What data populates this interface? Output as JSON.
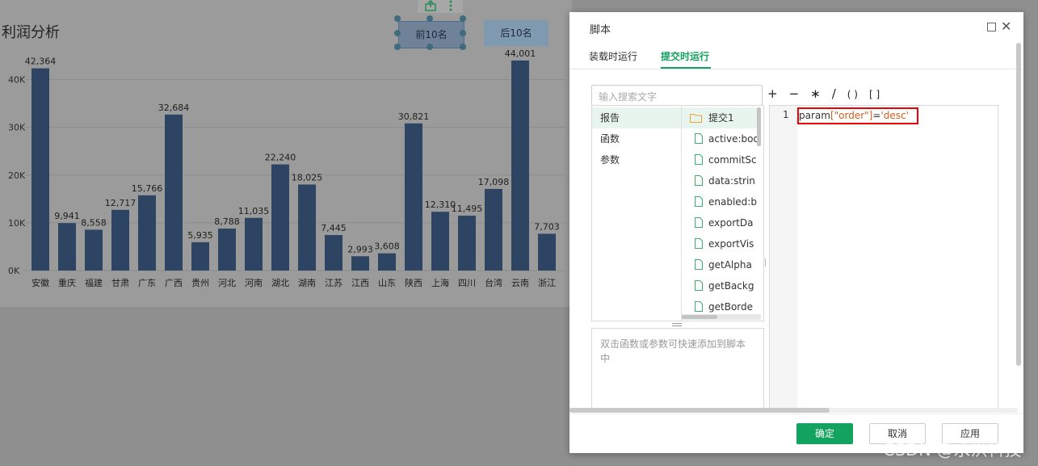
{
  "report": {
    "title": "利润分析",
    "btn_top10": "前10名",
    "btn_bottom10": "后10名"
  },
  "chart_data": {
    "type": "bar",
    "categories": [
      "安徽",
      "重庆",
      "福建",
      "甘肃",
      "广东",
      "广西",
      "贵州",
      "河北",
      "河南",
      "湖北",
      "湖南",
      "江苏",
      "江西",
      "山东",
      "陕西",
      "上海",
      "四川",
      "台湾",
      "云南",
      "浙江"
    ],
    "values": [
      42364,
      9941,
      8558,
      12717,
      15766,
      32684,
      5935,
      8788,
      11035,
      22240,
      18025,
      7445,
      2993,
      3608,
      30821,
      12310,
      11495,
      17098,
      44001,
      7703
    ],
    "value_labels": [
      "42,364",
      "9,941",
      "8,558",
      "12,717",
      "15,766",
      "32,684",
      "5,935",
      "8,788",
      "11,035",
      "22,240",
      "18,025",
      "7,445",
      "2,993",
      "3,608",
      "30,821",
      "12,310",
      "11,495",
      "17,098",
      "44,001",
      "7,703"
    ],
    "ytick_labels": [
      "0K",
      "10K",
      "20K",
      "30K",
      "40K"
    ],
    "ytick_values": [
      0,
      10000,
      20000,
      30000,
      40000
    ],
    "ylim": [
      0,
      45000
    ],
    "bar_color": "#2d4562",
    "grid": true
  },
  "dialog": {
    "title": "脚本",
    "tabs": [
      {
        "label": "装载时运行"
      },
      {
        "label": "提交时运行"
      }
    ],
    "search_placeholder": "输入搜索文字",
    "operators": [
      "+",
      "−",
      "∗",
      "/",
      "( )",
      "[ ]"
    ],
    "categories": [
      "报告",
      "函数",
      "参数"
    ],
    "tree_folder": "提交1",
    "tree_items": [
      "active:boo",
      "commitSc",
      "data:strin",
      "enabled:b",
      "exportDa",
      "exportVis",
      "getAlpha",
      "getBackg",
      "getBorde"
    ],
    "help_text": "双击函数或参数可快速添加到脚本中",
    "line_number": "1",
    "code": {
      "p1": "param",
      "p2": "[\"order\"]",
      "p3": "=",
      "p4": "'desc'"
    },
    "ok_label": "确定",
    "cancel_label": "取消",
    "apply_label": "应用"
  },
  "watermark": "CSDN @永洪科技",
  "colors": {
    "accent": "#13a25f",
    "bar": "#2d4562"
  }
}
